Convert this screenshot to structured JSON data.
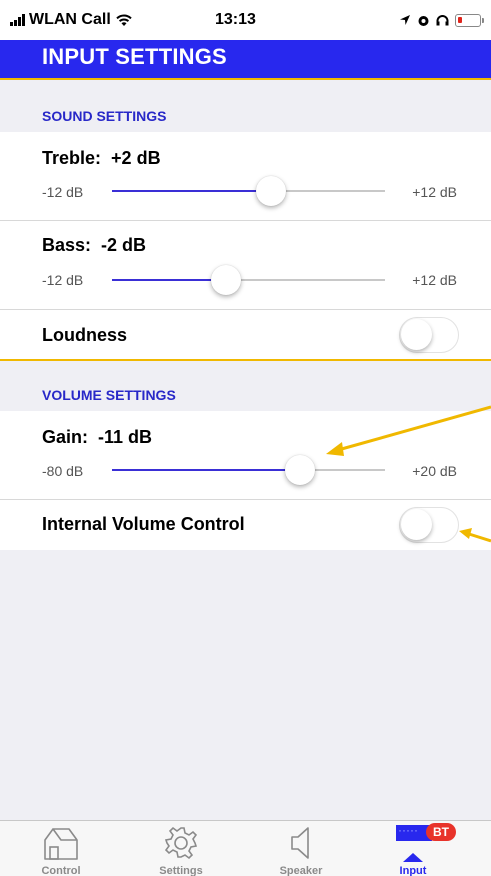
{
  "status_bar": {
    "carrier": "WLAN Call",
    "time": "13:13",
    "battery_color": "#e0241b"
  },
  "header": {
    "title": "INPUT SETTINGS",
    "background_color": "#2828ee",
    "accent_color": "#f0b800"
  },
  "sound_settings": {
    "section_label": "SOUND SETTINGS",
    "treble": {
      "label": "Treble:",
      "value_text": "+2 dB",
      "min_label": "-12 dB",
      "max_label": "+12 dB",
      "min": -12,
      "max": 12,
      "value": 2
    },
    "bass": {
      "label": "Bass:",
      "value_text": "-2 dB",
      "min_label": "-12 dB",
      "max_label": "+12 dB",
      "min": -12,
      "max": 12,
      "value": -2
    },
    "loudness": {
      "label": "Loudness",
      "on": false
    }
  },
  "volume_settings": {
    "section_label": "VOLUME SETTINGS",
    "gain": {
      "label": "Gain:",
      "value_text": "-11 dB",
      "min_label": "-80 dB",
      "max_label": "+20 dB",
      "min": -80,
      "max": 20,
      "value": -11
    },
    "internal_volume_control": {
      "label": "Internal Volume Control",
      "on": false
    }
  },
  "tab_bar": {
    "tabs": [
      {
        "label": "Control",
        "icon": "house-icon",
        "active": false
      },
      {
        "label": "Settings",
        "icon": "gear-icon",
        "active": false
      },
      {
        "label": "Speaker",
        "icon": "speaker-icon",
        "active": false
      },
      {
        "label": "Input",
        "icon": "input-icon",
        "active": true
      }
    ],
    "badge": "BT",
    "active_color": "#2828ee",
    "badge_color": "#e8332a"
  }
}
